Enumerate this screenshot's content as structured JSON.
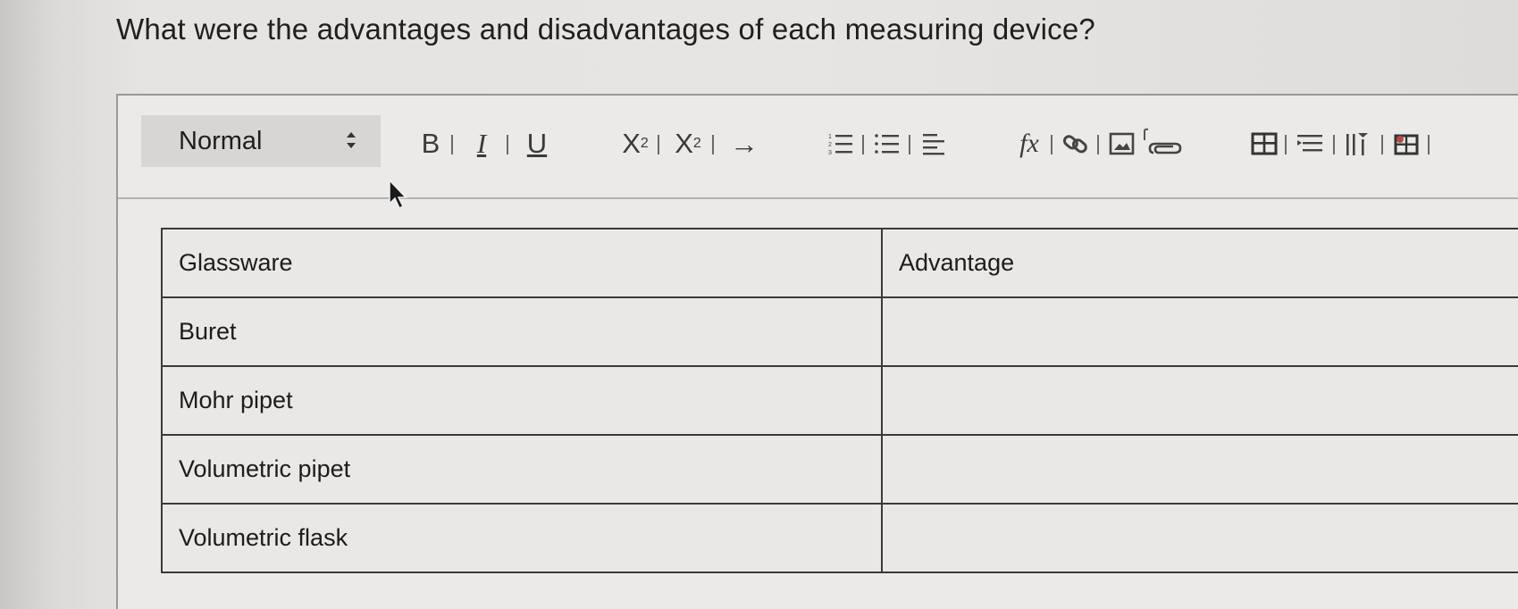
{
  "question": "What were the advantages and disadvantages of each measuring device?",
  "toolbar": {
    "format_select": {
      "value": "Normal"
    },
    "bold_label": "B",
    "italic_label": "I",
    "underline_label": "U",
    "subscript_label": "X",
    "subscript_sub": "2",
    "superscript_label": "X",
    "superscript_sup": "2",
    "arrow_label": "→",
    "formula_label": "fx",
    "icons": [
      "ordered-list-icon",
      "unordered-list-icon",
      "align-icon",
      "formula-icon",
      "link-icon",
      "image-icon",
      "attachment-icon",
      "table-icon",
      "row-icon",
      "column-icon",
      "cell-icon"
    ]
  },
  "table": {
    "headers": [
      "Glassware",
      "Advantage"
    ],
    "rows": [
      [
        "Buret",
        ""
      ],
      [
        "Mohr pipet",
        ""
      ],
      [
        "Volumetric pipet",
        ""
      ],
      [
        "Volumetric flask",
        ""
      ]
    ]
  }
}
